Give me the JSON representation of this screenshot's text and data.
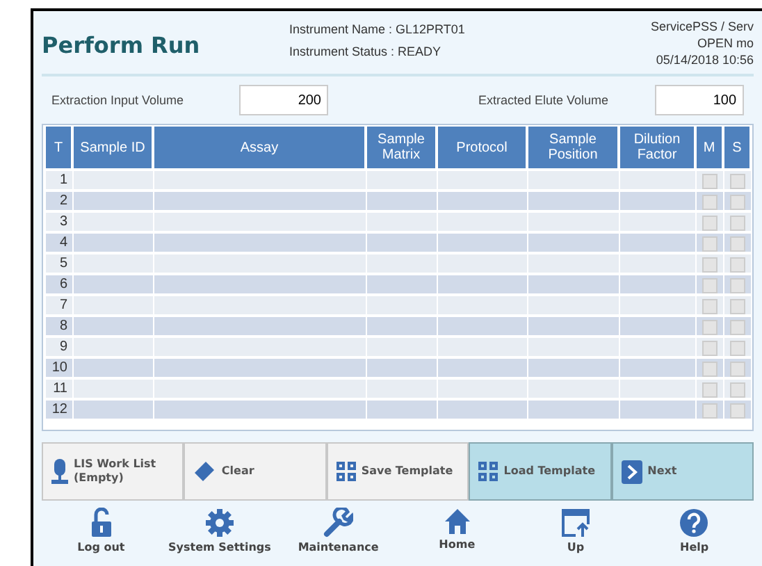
{
  "header": {
    "title": "Perform Run",
    "instrument_name": "Instrument Name :  GL12PRT01",
    "instrument_status": "Instrument Status : READY",
    "user": "ServicePSS / Serv",
    "mode": "OPEN mo",
    "datetime": "05/14/2018 10:56"
  },
  "fields": [
    {
      "label": "Extraction Input Volume",
      "value": "200"
    },
    {
      "label": "Extracted Elute Volume",
      "value": "100"
    }
  ],
  "table": {
    "columns": [
      "T",
      "Sample ID",
      "Assay",
      "Sample Matrix",
      "Protocol",
      "Sample Position",
      "Dilution Factor",
      "M",
      "S"
    ],
    "rows": [
      {
        "t": "1",
        "m_checked": false,
        "s_checked": false
      },
      {
        "t": "2",
        "m_checked": false,
        "s_checked": false
      },
      {
        "t": "3",
        "m_checked": false,
        "s_checked": false
      },
      {
        "t": "4",
        "m_checked": false,
        "s_checked": false
      },
      {
        "t": "5",
        "m_checked": false,
        "s_checked": false
      },
      {
        "t": "6",
        "m_checked": false,
        "s_checked": false
      },
      {
        "t": "7",
        "m_checked": false,
        "s_checked": false
      },
      {
        "t": "8",
        "m_checked": false,
        "s_checked": false
      },
      {
        "t": "9",
        "m_checked": false,
        "s_checked": false
      },
      {
        "t": "10",
        "m_checked": false,
        "s_checked": false
      },
      {
        "t": "11",
        "m_checked": false,
        "s_checked": false
      },
      {
        "t": "12",
        "m_checked": false,
        "s_checked": false
      }
    ]
  },
  "actions": [
    {
      "kind": "lis",
      "label": "LIS Work List\n(Empty)",
      "highlighted": false
    },
    {
      "kind": "clear",
      "label": "Clear",
      "highlighted": false
    },
    {
      "kind": "template",
      "label": "Save Template",
      "highlighted": false
    },
    {
      "kind": "template",
      "label": "Load Template",
      "highlighted": true
    },
    {
      "kind": "next",
      "label": "Next",
      "highlighted": true
    }
  ],
  "nav": [
    {
      "kind": "logout",
      "label": "Log out"
    },
    {
      "kind": "settings",
      "label": "System Settings"
    },
    {
      "kind": "maintenance",
      "label": "Maintenance"
    },
    {
      "kind": "home",
      "label": "Home"
    },
    {
      "kind": "up",
      "label": "Up"
    },
    {
      "kind": "help",
      "label": "Help"
    }
  ]
}
